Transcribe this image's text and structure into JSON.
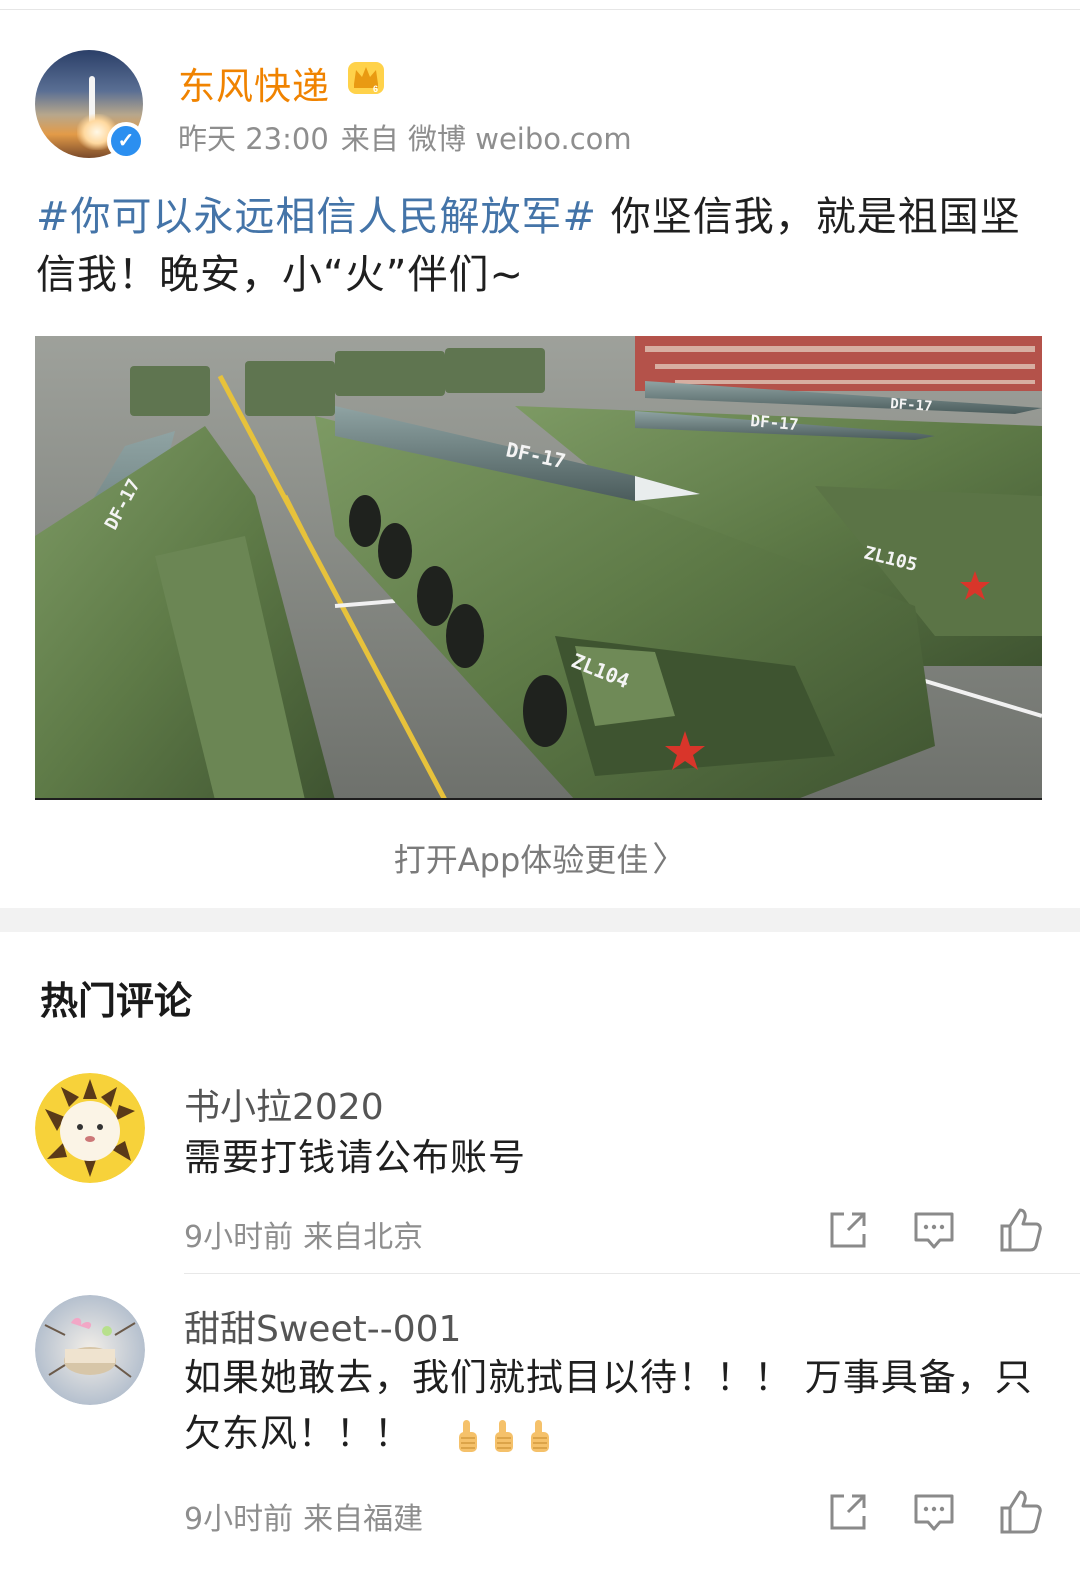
{
  "post": {
    "author": "东风快递",
    "time": "昨天 23:00",
    "source": "来自 微博 weibo.com",
    "topic": "#你可以永远相信人民解放军#",
    "text": " 你坚信我，就是祖国坚信我！晚安，小“火”伴们~",
    "image_labels": {
      "missile_center": "DF-17",
      "missile_right_1": "DF-17",
      "missile_right_2": "DF-17",
      "missile_left": "DF-17",
      "truck_center": "ZL104",
      "truck_right": "ZL105"
    }
  },
  "open_app": {
    "label": "打开App体验更佳",
    "chevron": "〉"
  },
  "hot_comments_title": "热门评论",
  "comments": [
    {
      "name": "书小拉2020",
      "text": "需要打钱请公布账号",
      "time": "9小时前",
      "location": "来自北京",
      "avatar_icon": "lion-avatar"
    },
    {
      "name": "甜甜Sweet--001",
      "text_line1": "如果她敢去，我们就拭目以待！！！ 万事具备，只",
      "text_line2": "欠东风！！！",
      "emoji": [
        "thumbs-up",
        "thumbs-up",
        "thumbs-up"
      ],
      "time": "9小时前",
      "location": "来自福建",
      "avatar_icon": "birthday-cake-avatar"
    }
  ],
  "colors": {
    "author": "#f08300",
    "topic": "#4474a8",
    "meta": "#8e8e8e",
    "verified": "#2b8ff0"
  },
  "icons": {
    "share": "share-icon",
    "comment": "comment-icon",
    "like": "like-icon",
    "verified": "verified-icon",
    "crown": "crown-icon"
  }
}
